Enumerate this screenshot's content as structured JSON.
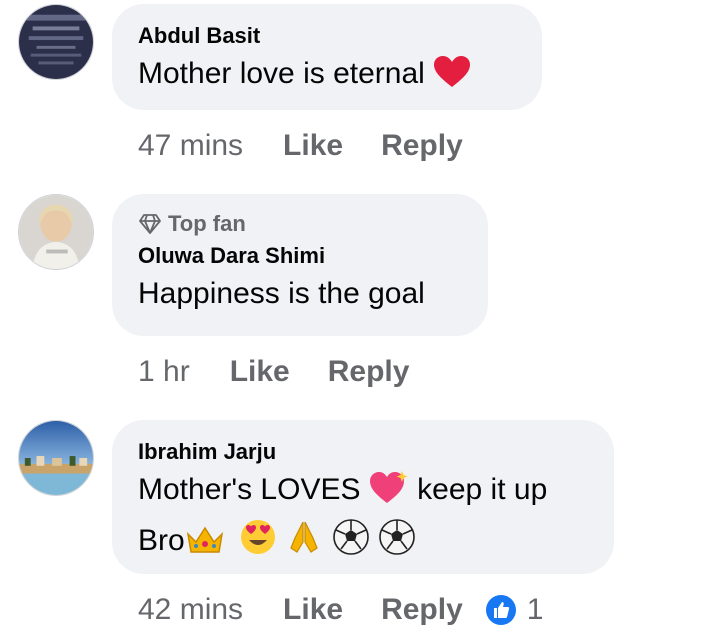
{
  "comments": [
    {
      "author": "Abdul Basit",
      "text": "Mother love is eternal",
      "time": "47 mins",
      "like_label": "Like",
      "reply_label": "Reply",
      "emojis": [
        "red-heart"
      ]
    },
    {
      "badge": "Top fan",
      "author": "Oluwa Dara Shimi",
      "text": "Happiness is the goal",
      "time": "1 hr",
      "like_label": "Like",
      "reply_label": "Reply"
    },
    {
      "author": "Ibrahim Jarju",
      "text_line1": "Mother's LOVES",
      "text_line1_after": "keep it up",
      "text_line2": "Bro",
      "emojis": [
        "sparkling-heart",
        "crown",
        "heart-eyes",
        "folded-hands",
        "soccer-ball",
        "soccer-ball"
      ],
      "time": "42 mins",
      "like_label": "Like",
      "reply_label": "Reply",
      "reaction": {
        "type": "like",
        "count": "1",
        "color": "#1877f2"
      }
    }
  ],
  "colors": {
    "bubble": "#f0f2f5",
    "secondary_text": "#65676b",
    "primary_text": "#050505",
    "like_blue": "#1877f2",
    "heart_red": "#e41e3f"
  }
}
